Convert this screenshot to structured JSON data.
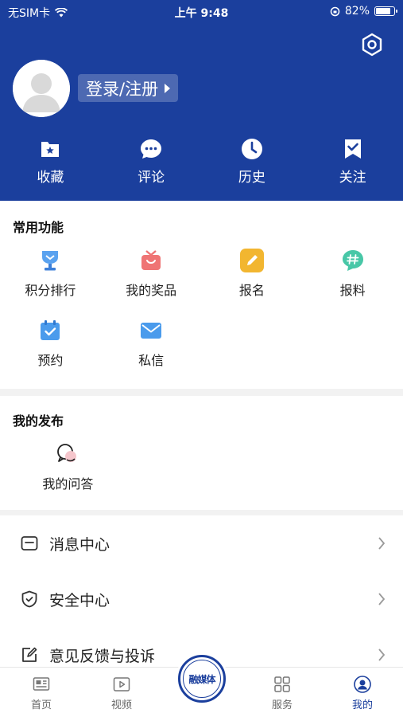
{
  "status_bar": {
    "carrier": "无SIM卡",
    "time": "上午 9:48",
    "battery": "82%",
    "battery_level": 0.82
  },
  "profile": {
    "login_label": "登录/注册"
  },
  "header_nav": [
    {
      "label": "收藏",
      "icon": "bookmark-star-icon"
    },
    {
      "label": "评论",
      "icon": "comment-icon"
    },
    {
      "label": "历史",
      "icon": "clock-icon"
    },
    {
      "label": "关注",
      "icon": "follow-icon"
    }
  ],
  "common": {
    "title": "常用功能",
    "items": [
      {
        "label": "积分排行",
        "icon": "trophy-icon",
        "color": "#4a8de0"
      },
      {
        "label": "我的奖品",
        "icon": "gift-icon",
        "color": "#ec6c6c"
      },
      {
        "label": "报名",
        "icon": "pencil-icon",
        "color": "#f2b630"
      },
      {
        "label": "报料",
        "icon": "hash-icon",
        "color": "#45c3a4"
      },
      {
        "label": "预约",
        "icon": "calendar-check-icon",
        "color": "#3c94ea"
      },
      {
        "label": "私信",
        "icon": "mail-icon",
        "color": "#3c94ea"
      }
    ]
  },
  "publish": {
    "title": "我的发布",
    "items": [
      {
        "label": "我的问答",
        "icon": "qa-chat-icon"
      }
    ]
  },
  "menu": [
    {
      "label": "消息中心",
      "icon": "message-icon"
    },
    {
      "label": "安全中心",
      "icon": "shield-icon"
    },
    {
      "label": "意见反馈与投诉",
      "icon": "feedback-edit-icon"
    }
  ],
  "tabbar": {
    "tabs": [
      {
        "label": "首页",
        "icon": "news-icon",
        "active": false
      },
      {
        "label": "视频",
        "icon": "video-icon",
        "active": false
      },
      {
        "label": "服务",
        "icon": "grid-icon",
        "active": false
      },
      {
        "label": "我的",
        "icon": "user-icon",
        "active": true
      }
    ],
    "center_label": "融媒体",
    "active_color": "#1b3f9d"
  }
}
